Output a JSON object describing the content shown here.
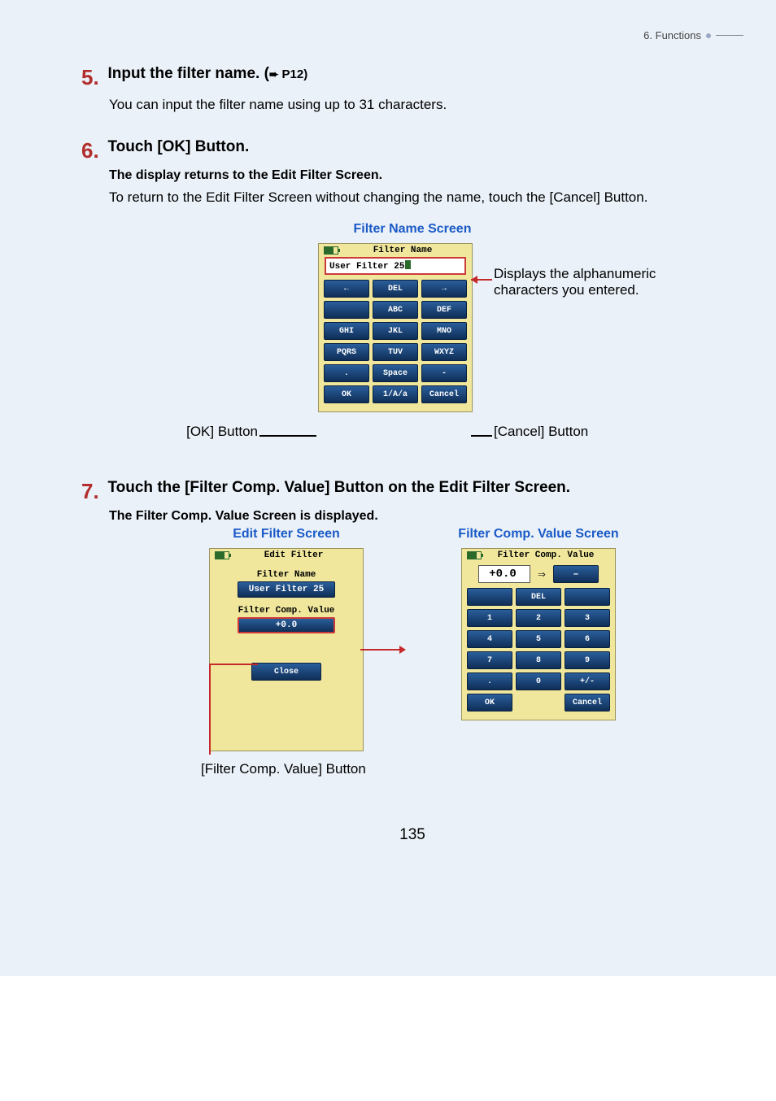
{
  "header": {
    "section": "6.  Functions"
  },
  "steps": {
    "s5": {
      "num": "5.",
      "title": "Input the filter name. (",
      "ref": "P12)",
      "body": "You can input the filter name using up to 31 characters."
    },
    "s6": {
      "num": "6.",
      "title": "Touch [OK] Button.",
      "sub": "The display returns to the Edit Filter Screen.",
      "body": "To return to the Edit Filter Screen without changing the name, touch the [Cancel] Button."
    },
    "s7": {
      "num": "7.",
      "title": "Touch the [Filter Comp. Value] Button on the Edit Filter Screen.",
      "sub": "The Filter Comp. Value Screen is displayed."
    }
  },
  "fig1": {
    "caption": "Filter Name Screen",
    "panel_title": "Filter Name",
    "field_value": "User Filter 25",
    "keys": {
      "r1": [
        "←",
        "DEL",
        "→"
      ],
      "r2": [
        "",
        "ABC",
        "DEF"
      ],
      "r3": [
        "GHI",
        "JKL",
        "MNO"
      ],
      "r4": [
        "PQRS",
        "TUV",
        "WXYZ"
      ],
      "r5": [
        ".",
        "Space",
        "-"
      ],
      "r6": [
        "OK",
        "1/A/a",
        "Cancel"
      ]
    },
    "annot_left": "[OK] Button",
    "annot_right_top": "Displays the alphanumeric characters you entered.",
    "annot_right_bottom": "[Cancel] Button"
  },
  "fig2a": {
    "caption": "Edit Filter Screen",
    "panel_title": "Edit Filter",
    "label1": "Filter Name",
    "value1": "User Filter 25",
    "label2": "Filter Comp. Value",
    "value2": "+0.0",
    "close": "Close",
    "below": "[Filter Comp. Value] Button"
  },
  "fig2b": {
    "caption": "Filter Comp. Value Screen",
    "panel_title": "Filter Comp. Value",
    "display": "+0.0",
    "display_dash": "–",
    "keys": {
      "r1": [
        "",
        "DEL",
        ""
      ],
      "r2": [
        "1",
        "2",
        "3"
      ],
      "r3": [
        "4",
        "5",
        "6"
      ],
      "r4": [
        "7",
        "8",
        "9"
      ],
      "r5": [
        ".",
        "0",
        "+/-"
      ],
      "r6": [
        "OK",
        "",
        "Cancel"
      ]
    }
  },
  "page_number": "135"
}
